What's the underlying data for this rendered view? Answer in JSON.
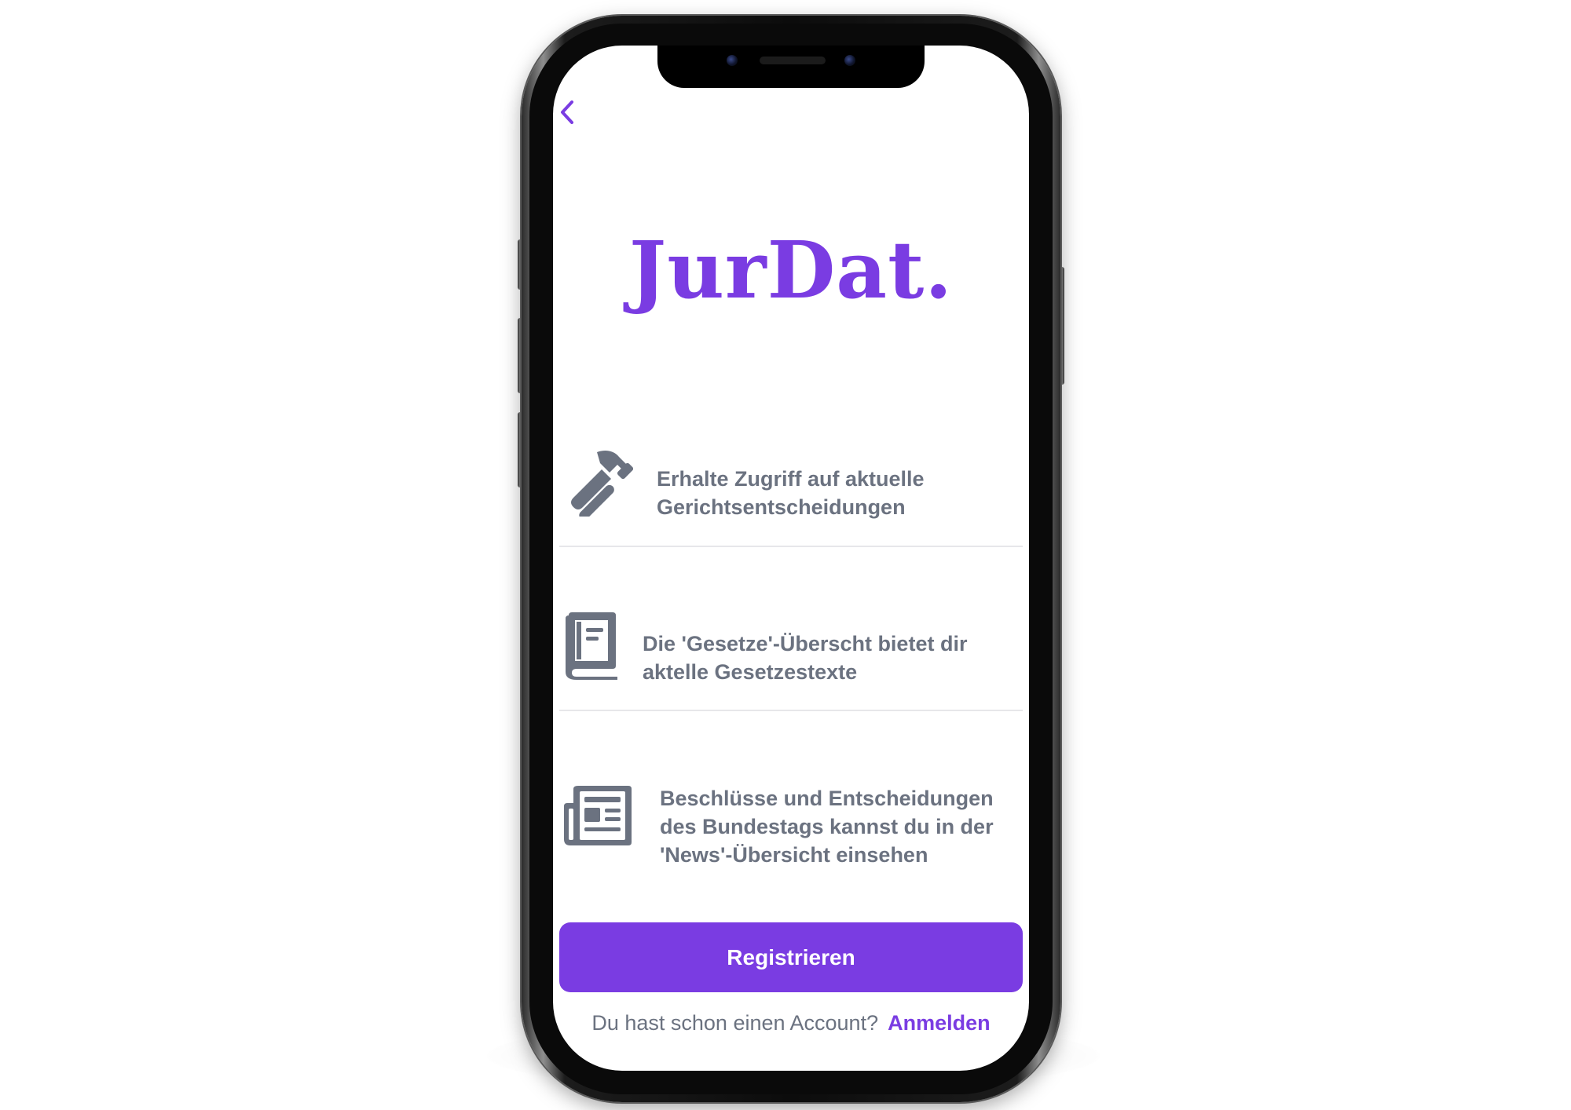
{
  "app": {
    "logo_text": "JurDat.",
    "brand_color": "#7a3ce2",
    "text_color": "#6b7280"
  },
  "nav": {
    "back_icon": "chevron-left-icon"
  },
  "features": [
    {
      "icon": "hammer-icon",
      "text": "Erhalte Zugriff auf aktuelle\nGerichtsentscheidungen"
    },
    {
      "icon": "law-book-icon",
      "text": "Die 'Gesetze'-Überscht bietet dir\naktelle Gesetzestexte"
    },
    {
      "icon": "newspaper-icon",
      "text": "Beschlüsse und Entscheidungen\ndes Bundestags kannst du in der\n'News'-Übersicht einsehen"
    }
  ],
  "actions": {
    "register_label": "Registrieren",
    "signin_prompt": "Du hast schon einen Account?",
    "signin_link": "Anmelden"
  }
}
